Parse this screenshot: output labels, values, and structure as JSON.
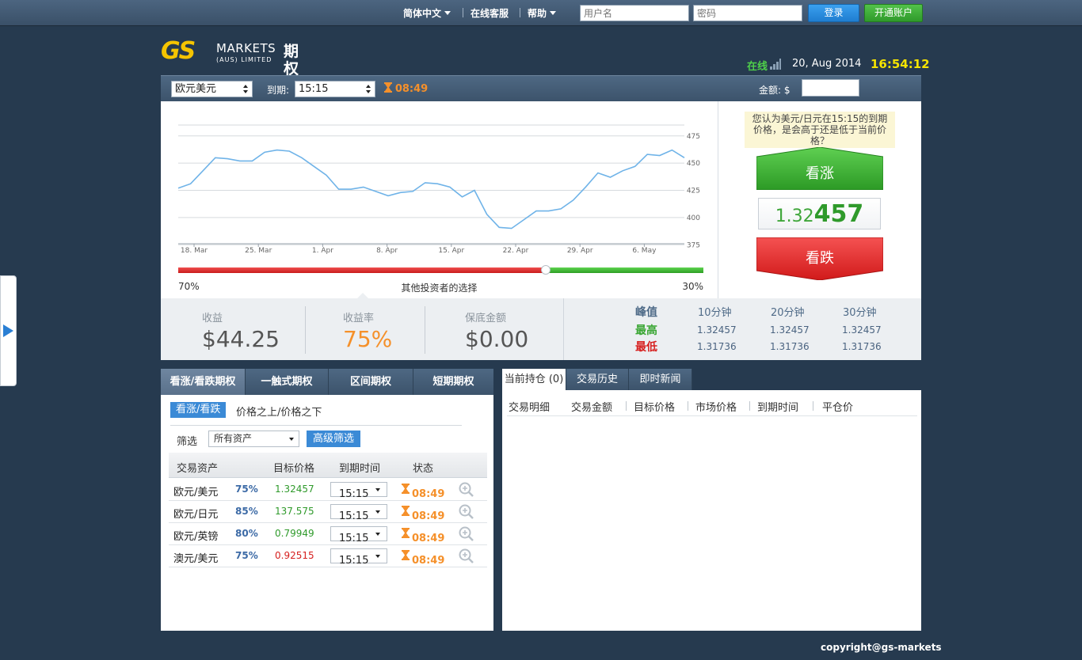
{
  "topbar": {
    "language": "简体中文",
    "support": "在线客服",
    "help": "帮助",
    "username_placeholder": "用户名",
    "password_placeholder": "密码",
    "login_label": "登录",
    "open_account_label": "开通账户"
  },
  "logo": {
    "mark": "GS",
    "markets": "MARKETS",
    "subtitle": "(AUS) LIMITED",
    "product": "期权"
  },
  "status": {
    "online": "在线",
    "date": "20,  Aug 2014",
    "time": "16:54:12"
  },
  "trade_bar": {
    "asset": "欧元美元",
    "expiry_label": "到期:",
    "expiry": "15:15",
    "countdown": "08:49",
    "amount_label": "金额: $",
    "amount_value": ""
  },
  "chart_data": {
    "type": "line",
    "x_ticks": [
      "18. Mar",
      "25. Mar",
      "1. Apr",
      "8. Apr",
      "15. Apr",
      "22. Apr",
      "29. Apr",
      "6. May"
    ],
    "y_ticks": [
      375,
      400,
      425,
      450,
      475
    ],
    "ylim": [
      365,
      485
    ],
    "series": [
      {
        "values": [
          427,
          431,
          443,
          455,
          454,
          452,
          452,
          460,
          462,
          461,
          455,
          447,
          439,
          426,
          426,
          428,
          424,
          420,
          423,
          424,
          432,
          431,
          428,
          419,
          425,
          403,
          391,
          390,
          398,
          406,
          406,
          408,
          416,
          428,
          441,
          437,
          443,
          447,
          458,
          457,
          462,
          455
        ]
      }
    ],
    "title": "",
    "xlabel": "",
    "ylabel": ""
  },
  "sentiment": {
    "caption": "其他投资者的选择",
    "left_pct": "70%",
    "right_pct": "30%",
    "left_fraction": 0.7
  },
  "prediction": {
    "question": "您认为美元/日元在15:15的到期价格，是会高于还是低于当前价格？",
    "call_label": "看涨",
    "put_label": "看跌",
    "price_prefix": "1.32",
    "price_suffix": "457"
  },
  "stats": {
    "profit_label": "收益",
    "profit_value": "$44.25",
    "rate_label": "收益率",
    "rate_value": "75%",
    "guarantee_label": "保底金额",
    "guarantee_value": "$0.00"
  },
  "peak": {
    "title": "峰值",
    "columns": [
      "10分钟",
      "20分钟",
      "30分钟"
    ],
    "high_label": "最高",
    "low_label": "最低",
    "high_values": [
      "1.32457",
      "1.32457",
      "1.32457"
    ],
    "low_values": [
      "1.31736",
      "1.31736",
      "1.31736"
    ]
  },
  "options": {
    "tabs": [
      "看涨/看跌期权",
      "一触式期权",
      "区间期权",
      "短期期权"
    ],
    "sub_active": "看涨/看跌",
    "sub_other": "价格之上/价格之下",
    "filter_label": "筛选",
    "filter_value": "所有资产",
    "advanced_label": "高级筛选",
    "headers": [
      "交易资产",
      "目标价格",
      "到期时间",
      "状态"
    ],
    "rows": [
      {
        "asset": "欧元/美元",
        "pct": "75%",
        "price": "1.32457",
        "price_color": "#2f9a2b",
        "expiry": "15:15",
        "status": "08:49"
      },
      {
        "asset": "欧元/日元",
        "pct": "85%",
        "price": "137.575",
        "price_color": "#2f9a2b",
        "expiry": "15:15",
        "status": "08:49"
      },
      {
        "asset": "欧元/英镑",
        "pct": "80%",
        "price": "0.79949",
        "price_color": "#2f9a2b",
        "expiry": "15:15",
        "status": "08:49"
      },
      {
        "asset": "澳元/美元",
        "pct": "75%",
        "price": "0.92515",
        "price_color": "#d6201f",
        "expiry": "15:15",
        "status": "08:49"
      }
    ]
  },
  "positions": {
    "tabs": [
      "当前持仓 (0)",
      "交易历史",
      "即时新闻"
    ],
    "headers": [
      "交易明细",
      "交易金额",
      "目标价格",
      "市场价格",
      "到期时间",
      "平仓价"
    ]
  },
  "copyright": "copyright@gs-markets",
  "colors": {
    "call": "#35a92f",
    "put": "#e8272a",
    "accent": "#3b8ad6",
    "countdown": "#f5902a"
  }
}
